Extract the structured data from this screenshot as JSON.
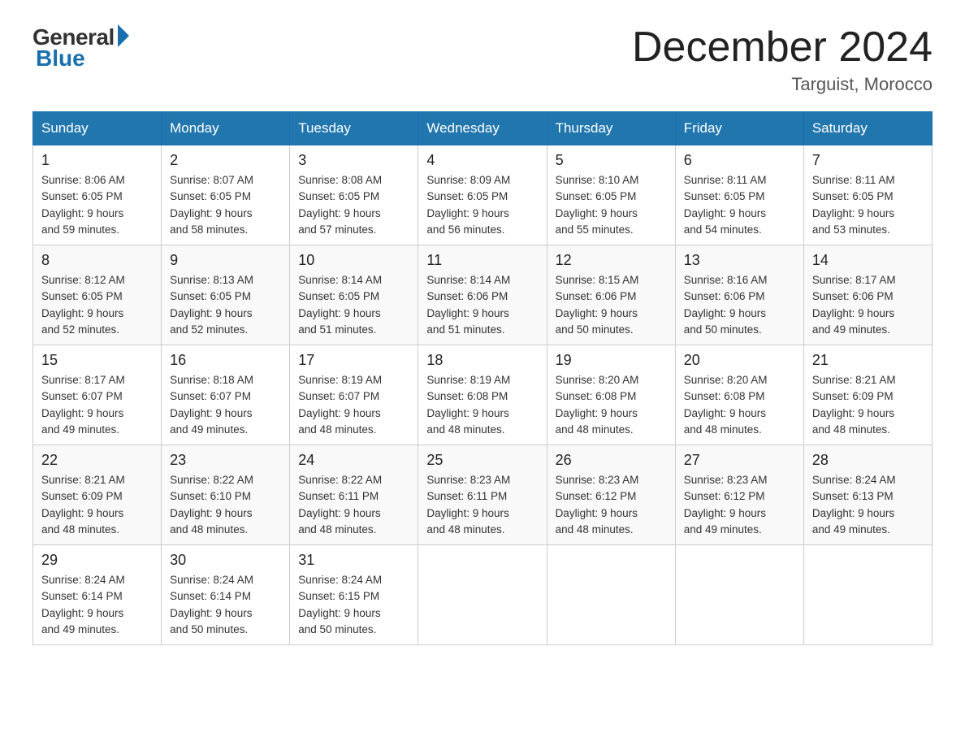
{
  "logo": {
    "general": "General",
    "blue": "Blue"
  },
  "title": "December 2024",
  "location": "Targuist, Morocco",
  "days_of_week": [
    "Sunday",
    "Monday",
    "Tuesday",
    "Wednesday",
    "Thursday",
    "Friday",
    "Saturday"
  ],
  "weeks": [
    [
      {
        "day": "1",
        "sunrise": "8:06 AM",
        "sunset": "6:05 PM",
        "daylight": "9 hours and 59 minutes."
      },
      {
        "day": "2",
        "sunrise": "8:07 AM",
        "sunset": "6:05 PM",
        "daylight": "9 hours and 58 minutes."
      },
      {
        "day": "3",
        "sunrise": "8:08 AM",
        "sunset": "6:05 PM",
        "daylight": "9 hours and 57 minutes."
      },
      {
        "day": "4",
        "sunrise": "8:09 AM",
        "sunset": "6:05 PM",
        "daylight": "9 hours and 56 minutes."
      },
      {
        "day": "5",
        "sunrise": "8:10 AM",
        "sunset": "6:05 PM",
        "daylight": "9 hours and 55 minutes."
      },
      {
        "day": "6",
        "sunrise": "8:11 AM",
        "sunset": "6:05 PM",
        "daylight": "9 hours and 54 minutes."
      },
      {
        "day": "7",
        "sunrise": "8:11 AM",
        "sunset": "6:05 PM",
        "daylight": "9 hours and 53 minutes."
      }
    ],
    [
      {
        "day": "8",
        "sunrise": "8:12 AM",
        "sunset": "6:05 PM",
        "daylight": "9 hours and 52 minutes."
      },
      {
        "day": "9",
        "sunrise": "8:13 AM",
        "sunset": "6:05 PM",
        "daylight": "9 hours and 52 minutes."
      },
      {
        "day": "10",
        "sunrise": "8:14 AM",
        "sunset": "6:05 PM",
        "daylight": "9 hours and 51 minutes."
      },
      {
        "day": "11",
        "sunrise": "8:14 AM",
        "sunset": "6:06 PM",
        "daylight": "9 hours and 51 minutes."
      },
      {
        "day": "12",
        "sunrise": "8:15 AM",
        "sunset": "6:06 PM",
        "daylight": "9 hours and 50 minutes."
      },
      {
        "day": "13",
        "sunrise": "8:16 AM",
        "sunset": "6:06 PM",
        "daylight": "9 hours and 50 minutes."
      },
      {
        "day": "14",
        "sunrise": "8:17 AM",
        "sunset": "6:06 PM",
        "daylight": "9 hours and 49 minutes."
      }
    ],
    [
      {
        "day": "15",
        "sunrise": "8:17 AM",
        "sunset": "6:07 PM",
        "daylight": "9 hours and 49 minutes."
      },
      {
        "day": "16",
        "sunrise": "8:18 AM",
        "sunset": "6:07 PM",
        "daylight": "9 hours and 49 minutes."
      },
      {
        "day": "17",
        "sunrise": "8:19 AM",
        "sunset": "6:07 PM",
        "daylight": "9 hours and 48 minutes."
      },
      {
        "day": "18",
        "sunrise": "8:19 AM",
        "sunset": "6:08 PM",
        "daylight": "9 hours and 48 minutes."
      },
      {
        "day": "19",
        "sunrise": "8:20 AM",
        "sunset": "6:08 PM",
        "daylight": "9 hours and 48 minutes."
      },
      {
        "day": "20",
        "sunrise": "8:20 AM",
        "sunset": "6:08 PM",
        "daylight": "9 hours and 48 minutes."
      },
      {
        "day": "21",
        "sunrise": "8:21 AM",
        "sunset": "6:09 PM",
        "daylight": "9 hours and 48 minutes."
      }
    ],
    [
      {
        "day": "22",
        "sunrise": "8:21 AM",
        "sunset": "6:09 PM",
        "daylight": "9 hours and 48 minutes."
      },
      {
        "day": "23",
        "sunrise": "8:22 AM",
        "sunset": "6:10 PM",
        "daylight": "9 hours and 48 minutes."
      },
      {
        "day": "24",
        "sunrise": "8:22 AM",
        "sunset": "6:11 PM",
        "daylight": "9 hours and 48 minutes."
      },
      {
        "day": "25",
        "sunrise": "8:23 AM",
        "sunset": "6:11 PM",
        "daylight": "9 hours and 48 minutes."
      },
      {
        "day": "26",
        "sunrise": "8:23 AM",
        "sunset": "6:12 PM",
        "daylight": "9 hours and 48 minutes."
      },
      {
        "day": "27",
        "sunrise": "8:23 AM",
        "sunset": "6:12 PM",
        "daylight": "9 hours and 49 minutes."
      },
      {
        "day": "28",
        "sunrise": "8:24 AM",
        "sunset": "6:13 PM",
        "daylight": "9 hours and 49 minutes."
      }
    ],
    [
      {
        "day": "29",
        "sunrise": "8:24 AM",
        "sunset": "6:14 PM",
        "daylight": "9 hours and 49 minutes."
      },
      {
        "day": "30",
        "sunrise": "8:24 AM",
        "sunset": "6:14 PM",
        "daylight": "9 hours and 50 minutes."
      },
      {
        "day": "31",
        "sunrise": "8:24 AM",
        "sunset": "6:15 PM",
        "daylight": "9 hours and 50 minutes."
      },
      null,
      null,
      null,
      null
    ]
  ],
  "labels": {
    "sunrise": "Sunrise:",
    "sunset": "Sunset:",
    "daylight": "Daylight:"
  }
}
